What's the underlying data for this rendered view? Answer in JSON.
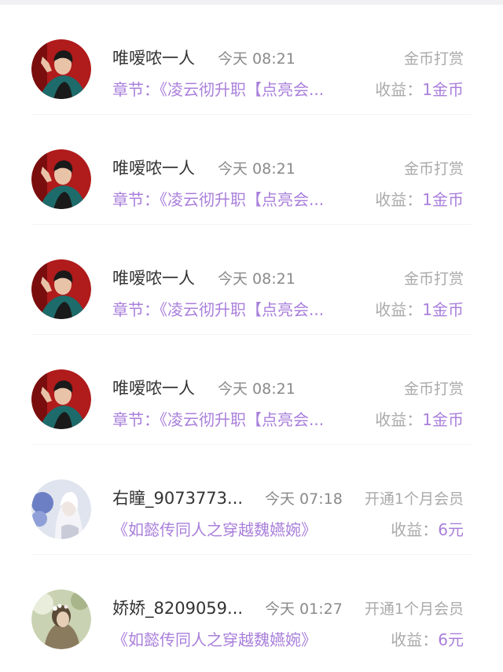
{
  "colors": {
    "accent_purple": "#a97fdb",
    "name_text": "#333333",
    "muted_text": "#aaaaaa",
    "divider": "#f3f3f5"
  },
  "records": [
    {
      "avatar_icon": "avatar-man-red-bg-icon",
      "name": "唯嗳哝一人",
      "time": "今天 08:21",
      "type": "金币打赏",
      "detail": "章节：《凌云彻升职【点亮会...",
      "income_label": "收益：",
      "income_value": "1金币"
    },
    {
      "avatar_icon": "avatar-man-red-bg-icon",
      "name": "唯嗳哝一人",
      "time": "今天 08:21",
      "type": "金币打赏",
      "detail": "章节：《凌云彻升职【点亮会...",
      "income_label": "收益：",
      "income_value": "1金币"
    },
    {
      "avatar_icon": "avatar-man-red-bg-icon",
      "name": "唯嗳哝一人",
      "time": "今天 08:21",
      "type": "金币打赏",
      "detail": "章节：《凌云彻升职【点亮会...",
      "income_label": "收益：",
      "income_value": "1金币"
    },
    {
      "avatar_icon": "avatar-man-red-bg-icon",
      "name": "唯嗳哝一人",
      "time": "今天 08:21",
      "type": "金币打赏",
      "detail": "章节：《凌云彻升职【点亮会...",
      "income_label": "收益：",
      "income_value": "1金币"
    },
    {
      "avatar_icon": "avatar-white-hair-flowers-icon",
      "name": "右瞳_9073773...",
      "time": "今天 07:18",
      "type": "开通1个月会员",
      "detail": "《如懿传同人之穿越魏嬿婉》",
      "income_label": "收益：",
      "income_value": "6元"
    },
    {
      "avatar_icon": "avatar-girl-garden-icon",
      "name": "娇娇_8209059...",
      "time": "今天 01:27",
      "type": "开通1个月会员",
      "detail": "《如懿传同人之穿越魏嬿婉》",
      "income_label": "收益：",
      "income_value": "6元"
    }
  ]
}
